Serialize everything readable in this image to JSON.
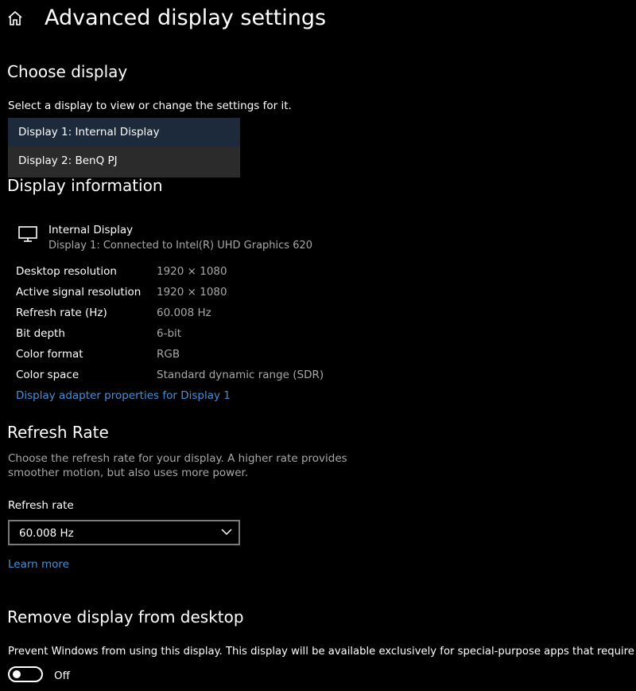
{
  "header": {
    "title": "Advanced display settings",
    "home_icon": "home-icon"
  },
  "choose_display": {
    "title": "Choose display",
    "description": "Select a display to view or change the settings for it.",
    "options": [
      {
        "label": "Display 1: Internal Display",
        "selected": true
      },
      {
        "label": "Display 2: BenQ PJ",
        "selected": false
      }
    ]
  },
  "display_information": {
    "title": "Display information",
    "monitor_icon": "monitor-icon",
    "display_name": "Internal Display",
    "display_subtitle": "Display 1: Connected to Intel(R) UHD Graphics 620",
    "rows": [
      {
        "label": "Desktop resolution",
        "value": "1920 × 1080"
      },
      {
        "label": "Active signal resolution",
        "value": "1920 × 1080"
      },
      {
        "label": "Refresh rate (Hz)",
        "value": "60.008 Hz"
      },
      {
        "label": "Bit depth",
        "value": "6-bit"
      },
      {
        "label": "Color format",
        "value": "RGB"
      },
      {
        "label": "Color space",
        "value": "Standard dynamic range (SDR)"
      }
    ],
    "adapter_link": "Display adapter properties for Display 1"
  },
  "refresh_rate": {
    "title": "Refresh Rate",
    "description_line1": "Choose the refresh rate for your display. A higher rate provides",
    "description_line2": "smoother motion, but also uses more power.",
    "field_label": "Refresh rate",
    "selected_value": "60.008 Hz",
    "learn_more": "Learn more"
  },
  "remove_display": {
    "title": "Remove display from desktop",
    "description": "Prevent Windows from using this display. This display will be available exclusively for special-purpose apps that require it.",
    "toggle_state": "Off"
  },
  "colors": {
    "background": "#000000",
    "accent_link": "#4a8fd6",
    "selected_option": "#1c2a3c",
    "dropdown_bg": "#2b2b2b",
    "secondary_text": "#a8a8a8"
  }
}
